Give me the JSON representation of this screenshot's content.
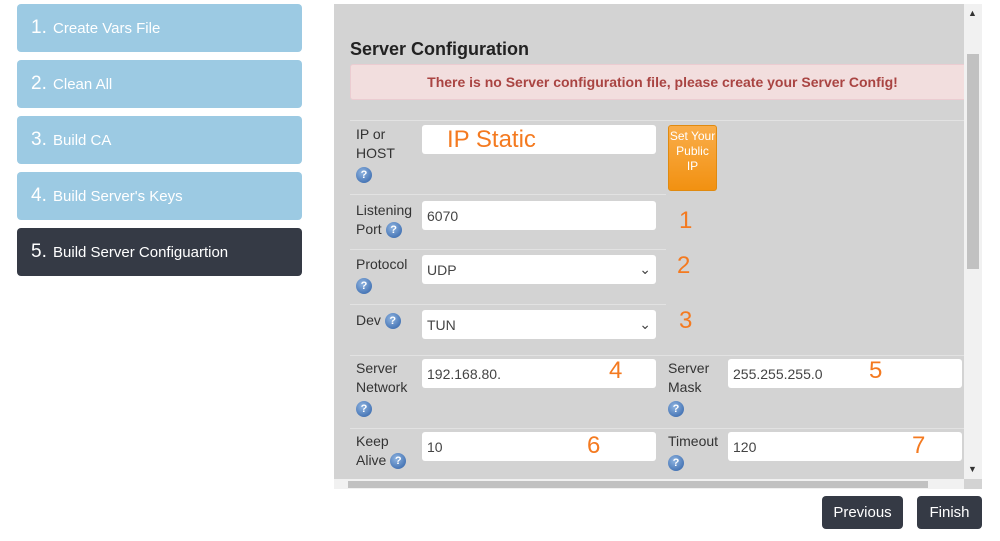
{
  "steps": [
    {
      "num": "1.",
      "label": "Create Vars File"
    },
    {
      "num": "2.",
      "label": "Clean All"
    },
    {
      "num": "3.",
      "label": "Build CA"
    },
    {
      "num": "4.",
      "label": "Build Server's Keys"
    },
    {
      "num": "5.",
      "label": "Build Server Configuartion",
      "active": true
    }
  ],
  "panel": {
    "title": "Server Configuration",
    "alert": "There is no Server configuration file, please create your Server Config!",
    "ip": {
      "label": "IP or HOST",
      "value": "IP Static"
    },
    "public_ip_button": "Set Your Public IP",
    "port": {
      "label": "Listening Port",
      "value": "6070",
      "annotation": "1"
    },
    "protocol": {
      "label": "Protocol",
      "value": "UDP",
      "annotation": "2"
    },
    "dev": {
      "label": "Dev",
      "value": "TUN",
      "annotation": "3"
    },
    "network": {
      "label": "Server Network",
      "value": "192.168.80.",
      "annotation": "4"
    },
    "mask": {
      "label": "Server Mask",
      "value": "255.255.255.0",
      "annotation": "5"
    },
    "keepalive": {
      "label": "Keep Alive",
      "value": "10",
      "annotation": "6"
    },
    "timeout": {
      "label": "Timeout",
      "value": "120",
      "annotation": "7"
    },
    "help_glyph": "?"
  },
  "buttons": {
    "previous": "Previous",
    "finish": "Finish"
  },
  "colors": {
    "step": "#9ccae3",
    "step_active": "#353a45",
    "annotation": "#f47a20",
    "alert_text": "#a94442"
  }
}
